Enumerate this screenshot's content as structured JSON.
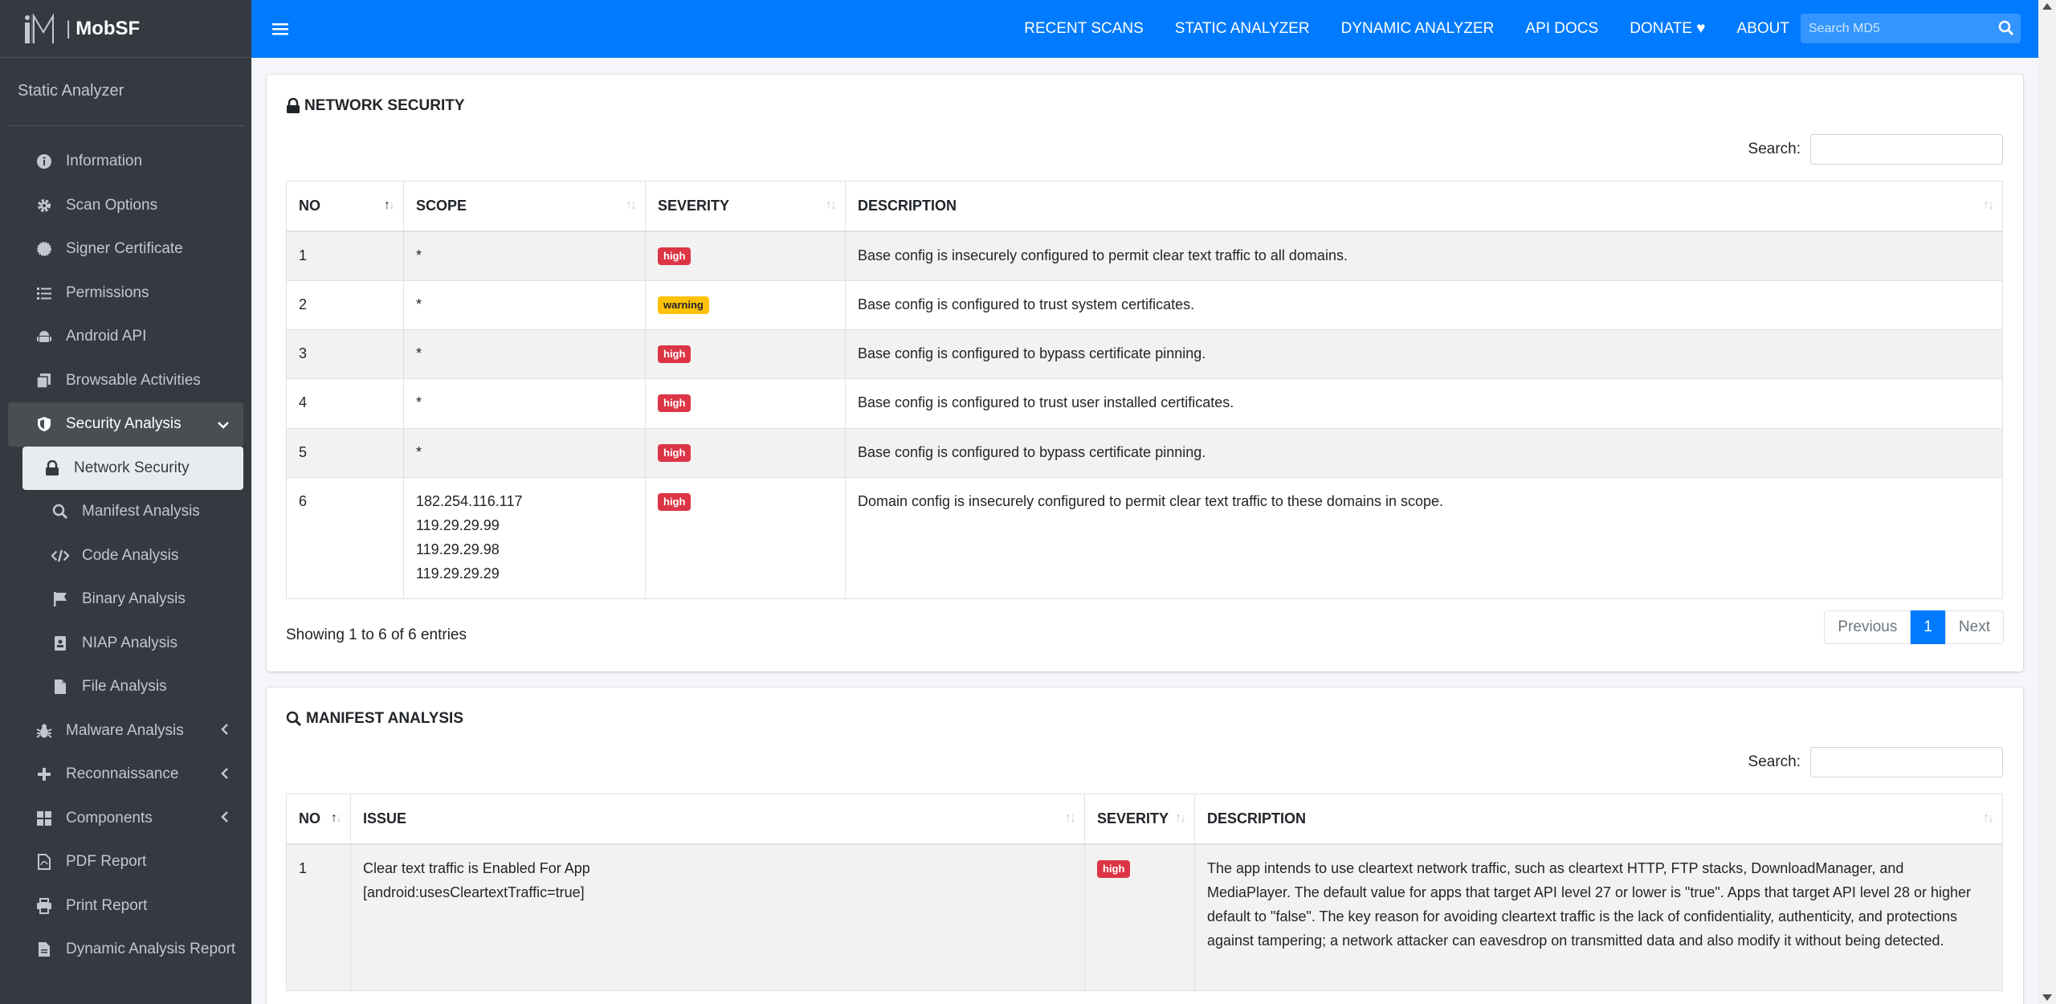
{
  "brand": {
    "name": "MobSF"
  },
  "sidebar": {
    "title": "Static Analyzer",
    "items": [
      {
        "label": "Information"
      },
      {
        "label": "Scan Options"
      },
      {
        "label": "Signer Certificate"
      },
      {
        "label": "Permissions"
      },
      {
        "label": "Android API"
      },
      {
        "label": "Browsable Activities"
      },
      {
        "label": "Security Analysis"
      },
      {
        "label": "Network Security"
      },
      {
        "label": "Manifest Analysis"
      },
      {
        "label": "Code Analysis"
      },
      {
        "label": "Binary Analysis"
      },
      {
        "label": "NIAP Analysis"
      },
      {
        "label": "File Analysis"
      },
      {
        "label": "Malware Analysis"
      },
      {
        "label": "Reconnaissance"
      },
      {
        "label": "Components"
      },
      {
        "label": "PDF Report"
      },
      {
        "label": "Print Report"
      },
      {
        "label": "Dynamic Analysis Report"
      }
    ]
  },
  "topnav": {
    "links": [
      "RECENT SCANS",
      "STATIC ANALYZER",
      "DYNAMIC ANALYZER",
      "API DOCS",
      "DONATE",
      "ABOUT"
    ],
    "search_placeholder": "Search MD5"
  },
  "network_security": {
    "title": "NETWORK SECURITY",
    "search_label": "Search:",
    "columns": [
      "NO",
      "SCOPE",
      "SEVERITY",
      "DESCRIPTION"
    ],
    "rows": [
      {
        "no": "1",
        "scope": [
          "*"
        ],
        "severity": "high",
        "description": "Base config is insecurely configured to permit clear text traffic to all domains."
      },
      {
        "no": "2",
        "scope": [
          "*"
        ],
        "severity": "warning",
        "description": "Base config is configured to trust system certificates."
      },
      {
        "no": "3",
        "scope": [
          "*"
        ],
        "severity": "high",
        "description": "Base config is configured to bypass certificate pinning."
      },
      {
        "no": "4",
        "scope": [
          "*"
        ],
        "severity": "high",
        "description": "Base config is configured to trust user installed certificates."
      },
      {
        "no": "5",
        "scope": [
          "*"
        ],
        "severity": "high",
        "description": "Base config is configured to bypass certificate pinning."
      },
      {
        "no": "6",
        "scope": [
          "182.254.116.117",
          "119.29.29.99",
          "119.29.29.98",
          "119.29.29.29"
        ],
        "severity": "high",
        "description": "Domain config is insecurely configured to permit clear text traffic to these domains in scope."
      }
    ],
    "showing": "Showing 1 to 6 of 6 entries",
    "pager": {
      "previous": "Previous",
      "current": "1",
      "next": "Next"
    }
  },
  "manifest_analysis": {
    "title": "MANIFEST ANALYSIS",
    "search_label": "Search:",
    "columns": [
      "NO",
      "ISSUE",
      "SEVERITY",
      "DESCRIPTION"
    ],
    "rows": [
      {
        "no": "1",
        "issue": [
          "Clear text traffic is Enabled For App",
          "[android:usesCleartextTraffic=true]"
        ],
        "severity": "high",
        "description": "The app intends to use cleartext network traffic, such as cleartext HTTP, FTP stacks, DownloadManager, and MediaPlayer. The default value for apps that target API level 27 or lower is \"true\". Apps that target API level 28 or higher default to \"false\". The key reason for avoiding cleartext traffic is the lack of confidentiality, authenticity, and protections against tampering; a network attacker can eavesdrop on transmitted data and also modify it without being detected."
      }
    ]
  },
  "colors": {
    "primary": "#007bff",
    "sidebar": "#343a40",
    "high": "#dc3545",
    "warning": "#ffc107"
  },
  "icons": [
    "menu-icon",
    "search-icon",
    "lock-icon",
    "info-icon",
    "gear-icon",
    "certificate-icon",
    "list-icon",
    "android-icon",
    "copy-icon",
    "shield-icon",
    "code-icon",
    "flag-icon",
    "id-card-icon",
    "file-icon",
    "bug-icon",
    "plus-icon",
    "grid-icon",
    "pdf-icon",
    "print-icon",
    "heart-icon"
  ]
}
